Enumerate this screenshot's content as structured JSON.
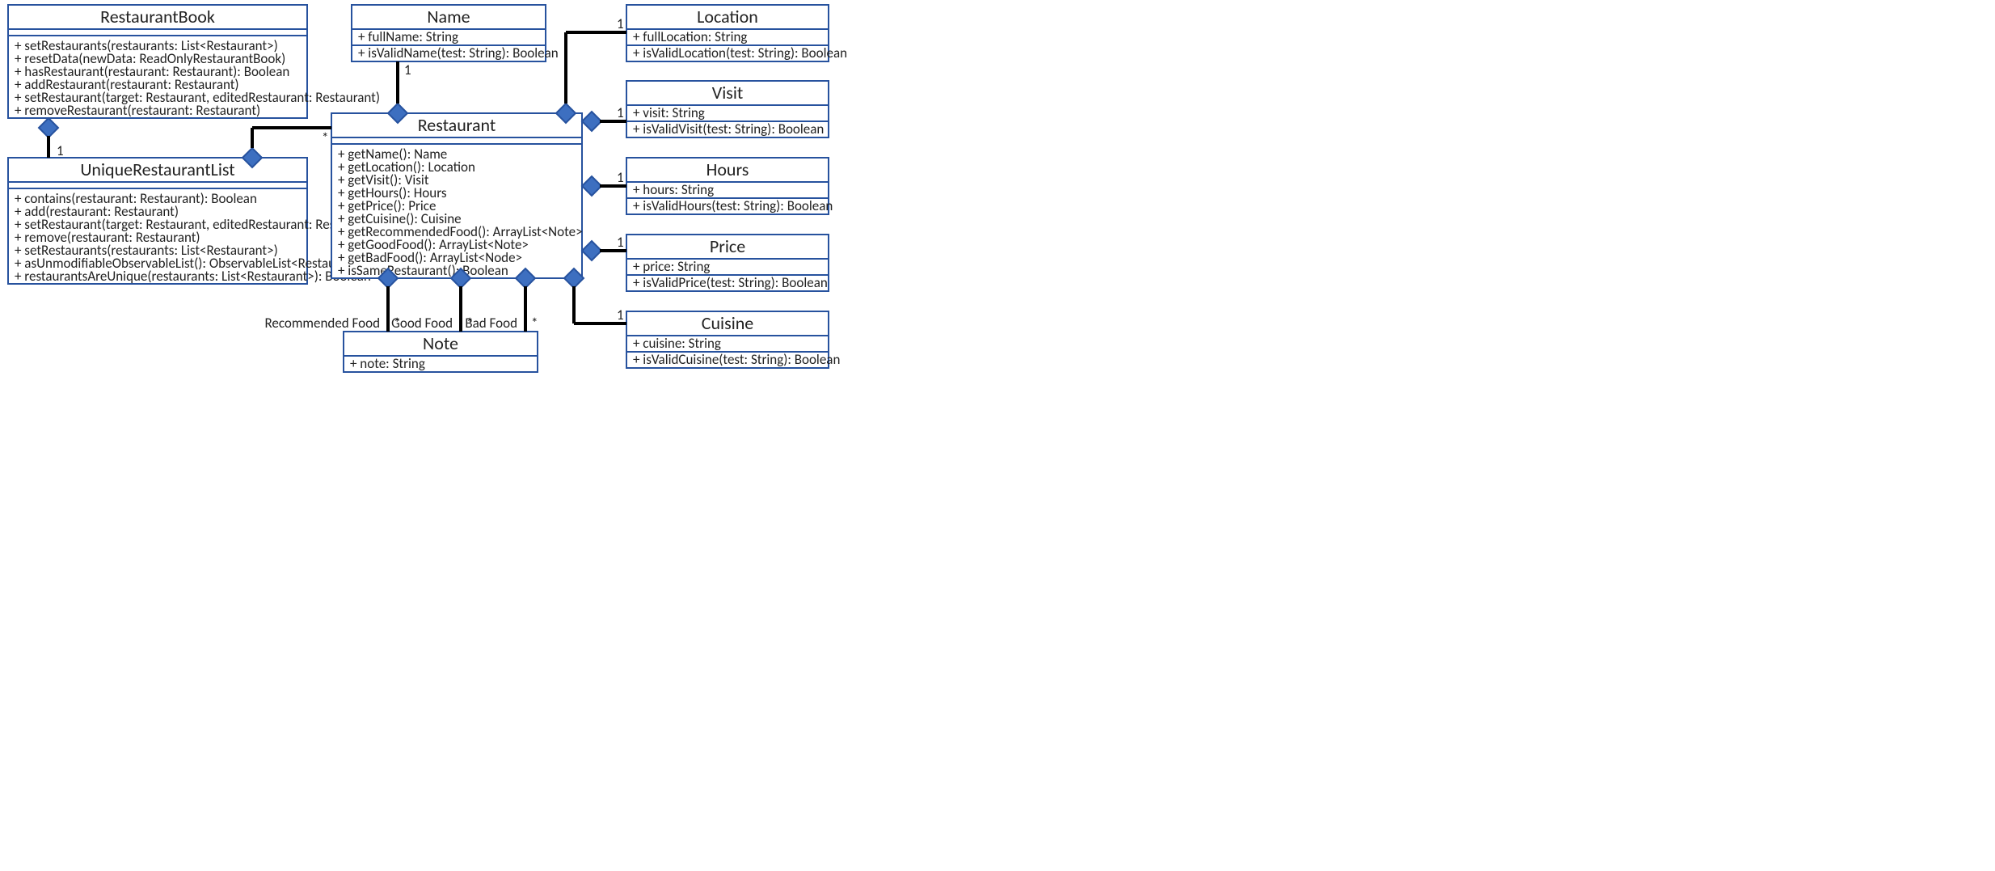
{
  "classes": {
    "restaurantBook": {
      "name": "RestaurantBook",
      "members": [
        "+ setRestaurants(restaurants: List<Restaurant>)",
        "+ resetData(newData: ReadOnlyRestaurantBook)",
        "+ hasRestaurant(restaurant: Restaurant): Boolean",
        "+ addRestaurant(restaurant: Restaurant)",
        "+ setRestaurant(target: Restaurant, editedRestaurant: Restaurant)",
        "+ removeRestaurant(restaurant: Restaurant)"
      ]
    },
    "uniqueRestaurantList": {
      "name": "UniqueRestaurantList",
      "members": [
        "+ contains(restaurant: Restaurant): Boolean",
        "+ add(restaurant: Restaurant)",
        "+ setRestaurant(target: Restaurant, editedRestaurant: Restaurant)",
        "+ remove(restaurant: Restaurant)",
        "+ setRestaurants(restaurants: List<Restaurant>)",
        "+ asUnmodifiableObservableList(): ObservableList<Restaurant>",
        "+ restaurantsAreUnique(restaurants: List<Restaurant>): Boolean"
      ]
    },
    "restaurant": {
      "name": "Restaurant",
      "members": [
        "+ getName(): Name",
        "+ getLocation(): Location",
        "+ getVisit(): Visit",
        "+ getHours(): Hours",
        "+ getPrice(): Price",
        "+ getCuisine(): Cuisine",
        "+ getRecommendedFood(): ArrayList<Note>",
        "+ getGoodFood(): ArrayList<Note>",
        "+ getBadFood(): ArrayList<Node>",
        "+ isSameRestaurant(): Boolean"
      ]
    },
    "name": {
      "name": "Name",
      "attrs": [
        "+ fullName: String"
      ],
      "ops": [
        "+ isValidName(test: String): Boolean"
      ]
    },
    "location": {
      "name": "Location",
      "attrs": [
        "+ fullLocation: String"
      ],
      "ops": [
        "+ isValidLocation(test: String): Boolean"
      ]
    },
    "visit": {
      "name": "Visit",
      "attrs": [
        "+ visit: String"
      ],
      "ops": [
        "+ isValidVisit(test: String): Boolean"
      ]
    },
    "hours": {
      "name": "Hours",
      "attrs": [
        "+ hours: String"
      ],
      "ops": [
        "+ isValidHours(test: String): Boolean"
      ]
    },
    "price": {
      "name": "Price",
      "attrs": [
        "+ price: String"
      ],
      "ops": [
        "+ isValidPrice(test: String): Boolean"
      ]
    },
    "cuisine": {
      "name": "Cuisine",
      "attrs": [
        "+ cuisine: String"
      ],
      "ops": [
        "+ isValidCuisine(test: String): Boolean"
      ]
    },
    "note": {
      "name": "Note",
      "attrs": [
        "+ note: String"
      ]
    }
  },
  "labels": {
    "recFood": "Recommended Food",
    "goodFood": "Good Food",
    "badFood": "Bad Food"
  },
  "mult": {
    "one": "1",
    "star": "*"
  }
}
